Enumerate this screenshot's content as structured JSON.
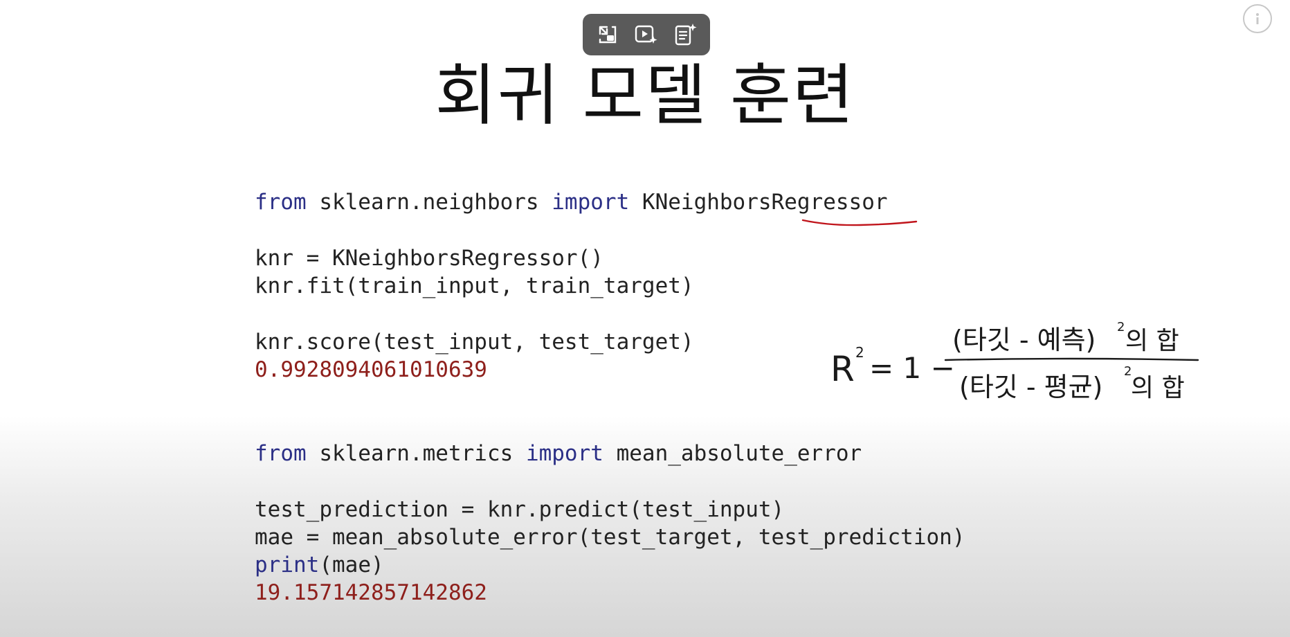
{
  "toolbar": {
    "buttons": [
      {
        "icon": "pip-icon"
      },
      {
        "icon": "video-sparkle-icon"
      },
      {
        "icon": "notes-sparkle-icon"
      }
    ]
  },
  "info": {
    "icon": "info-icon"
  },
  "slide": {
    "title": "회귀 모델 훈련",
    "block1": {
      "l1_kw1": "from",
      "l1_mod": " sklearn.neighbors ",
      "l1_kw2": "import",
      "l1_name": " KNeighborsRegressor",
      "l2": "knr = KNeighborsRegressor()",
      "l3": "knr.fit(train_input, train_target)",
      "l4": "knr.score(test_input, test_target)",
      "l5": "0.9928094061010639"
    },
    "block2": {
      "l1_kw1": "from",
      "l1_mod": " sklearn.metrics ",
      "l1_kw2": "import",
      "l1_name": " mean_absolute_error",
      "l2": "test_prediction = knr.predict(test_input)",
      "l3": "mae = mean_absolute_error(test_target, test_prediction)",
      "l4_kw": "print",
      "l4_rest": "(mae)",
      "l5": "19.157142857142862"
    },
    "formula": {
      "lhs": "R",
      "lhs_exp": "2",
      "eq": "= 1 −",
      "num": "(타깃 - 예측)",
      "num_exp": "2",
      "num_tail": "의 합",
      "den": "(타깃 - 평균)",
      "den_exp": "2",
      "den_tail": "의 합"
    }
  },
  "colors": {
    "keyword": "#2b2f86",
    "output": "#8e1f1b",
    "annotation": "#c0141b"
  }
}
